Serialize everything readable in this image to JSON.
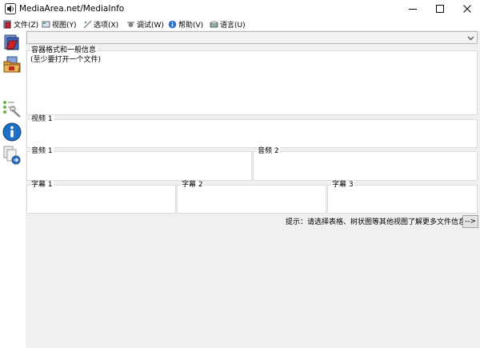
{
  "window": {
    "title": "MediaArea.net/MediaInfo",
    "icon": "speaker-icon"
  },
  "menu": {
    "items": [
      {
        "label": "文件(Z)",
        "icon": "file-icon"
      },
      {
        "label": "视图(Y)",
        "icon": "view-icon"
      },
      {
        "label": "选项(X)",
        "icon": "options-icon"
      },
      {
        "label": "调试(W)",
        "icon": "debug-icon"
      },
      {
        "label": "帮助(V)",
        "icon": "help-icon"
      },
      {
        "label": "语言(U)",
        "icon": "language-icon"
      }
    ]
  },
  "toolbar": {
    "icons": [
      "open-file-icon",
      "open-folder-icon",
      "sheet-tree-icon",
      "info-icon",
      "export-icon"
    ]
  },
  "file_selector": {
    "value": ""
  },
  "general": {
    "legend": "容器格式和一般信息",
    "body": "(至少要打开一个文件)"
  },
  "video": {
    "legend": "视频 1"
  },
  "audio": [
    {
      "legend": "音频 1"
    },
    {
      "legend": "音频 2"
    }
  ],
  "subtitles": [
    {
      "legend": "字幕 1"
    },
    {
      "legend": "字幕 2"
    },
    {
      "legend": "字幕 3"
    }
  ],
  "hint": {
    "text": "提示：请选择表格、树状图等其他视图了解更多文件信息",
    "button_label": "-->"
  }
}
